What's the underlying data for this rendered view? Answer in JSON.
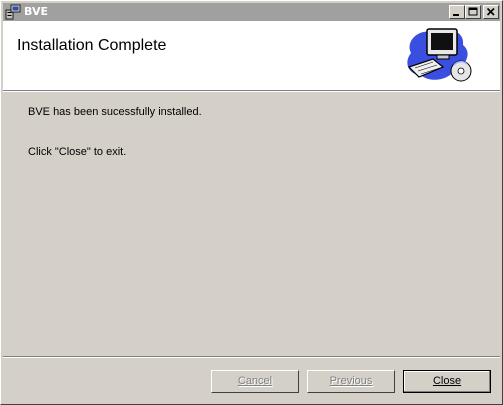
{
  "window": {
    "title": "BVE"
  },
  "header": {
    "title": "Installation Complete"
  },
  "body": {
    "line1": "BVE has been sucessfully installed.",
    "line2": "Click \"Close\" to exit."
  },
  "buttons": {
    "cancel": "Cancel",
    "previous": "Previous",
    "close": "Close"
  },
  "colors": {
    "titlebar_inactive": "#a0a0a0",
    "window_face": "#d4d0c8"
  },
  "icons": {
    "app": "installer-computer-icon",
    "header_art": "computer-with-cd-illustration"
  }
}
